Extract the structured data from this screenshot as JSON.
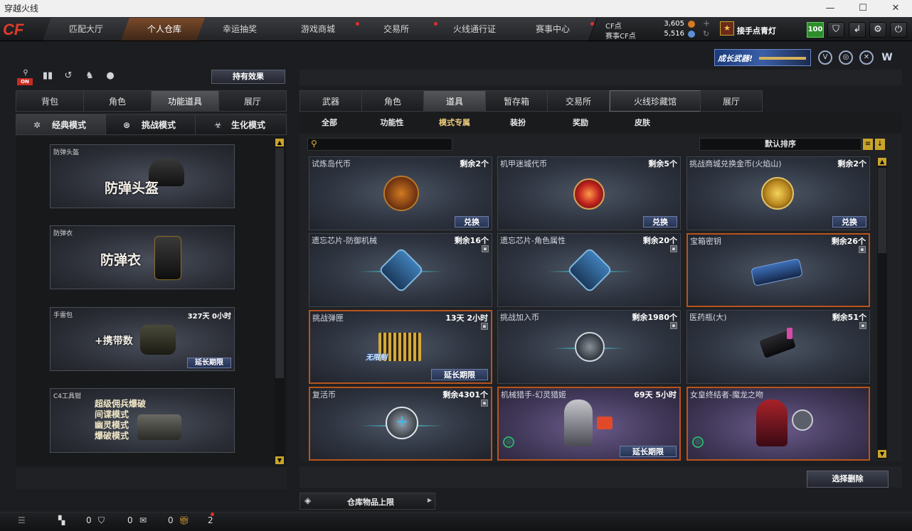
{
  "window": {
    "title": "穿越火线",
    "min": "—",
    "max": "☐",
    "close": "✕"
  },
  "logo": "CF",
  "nav": {
    "tabs": [
      "匹配大厅",
      "个人仓库",
      "幸运抽奖",
      "游戏商城",
      "交易所",
      "火线通行证",
      "赛事中心"
    ]
  },
  "currency": {
    "cf_label": "CF点",
    "cf_value": "3,605",
    "match_label": "赛事CF点",
    "match_value": "5,516"
  },
  "user": {
    "name": "接手点青灯",
    "level": "100"
  },
  "banner": "成长武器!",
  "left": {
    "effect_button": "持有效果",
    "on_badge": "ON",
    "tabs": [
      "背包",
      "角色",
      "功能道具",
      "展厅"
    ],
    "modes": [
      "经典模式",
      "挑战模式",
      "生化模式"
    ],
    "cards": [
      {
        "title": "防弹头盔",
        "big": "防弹头盔"
      },
      {
        "title": "防弹衣",
        "big": "防弹衣"
      },
      {
        "title": "手雷包",
        "time": "327天 0小时",
        "big": "+携带数",
        "action": "延长期限"
      },
      {
        "title": "C4工具钳",
        "lines": [
          "超级佣兵爆破",
          "间谍模式",
          "幽灵模式",
          "爆破模式"
        ]
      }
    ]
  },
  "right": {
    "tabs": [
      "武器",
      "角色",
      "道具",
      "暂存箱",
      "交易所",
      "火线珍藏馆",
      "展厅"
    ],
    "subtabs": [
      "全部",
      "功能性",
      "模式专属",
      "装扮",
      "奖励",
      "皮肤"
    ],
    "sort_label": "默认排序",
    "items": [
      {
        "name": "试炼岛代币",
        "count": "剩余2个",
        "action": "兑换"
      },
      {
        "name": "机甲迷城代币",
        "count": "剩余5个",
        "action": "兑换"
      },
      {
        "name": "挑战商城兑换金币(火焰山)",
        "count": "剩余2个",
        "action": "兑换"
      },
      {
        "name": "遗忘芯片-防御机械",
        "count": "剩余16个"
      },
      {
        "name": "遗忘芯片-角色属性",
        "count": "剩余20个"
      },
      {
        "name": "宝箱密钥",
        "count": "剩余26个"
      },
      {
        "name": "挑战弹匣",
        "count": "13天 2小时",
        "action": "延长期限",
        "art_text": "无限制"
      },
      {
        "name": "挑战加入币",
        "count": "剩余1980个"
      },
      {
        "name": "医药瓶(大)",
        "count": "剩余51个"
      },
      {
        "name": "复活币",
        "count": "剩余4301个"
      },
      {
        "name": "机械猎手-幻灵猎姬",
        "count": "69天 5小时",
        "action": "延长期限"
      },
      {
        "name": "女皇终结者-魔龙之吻",
        "count": ""
      }
    ],
    "delete_button": "选择删除",
    "storage_limit": "仓库物品上限"
  },
  "status": {
    "count1": "0",
    "count2": "0",
    "count3": "0",
    "gift_count": "2"
  },
  "colors": {
    "accent_orange": "#b9541d",
    "gold": "#c9a42b",
    "blue_btn": "#263353"
  }
}
